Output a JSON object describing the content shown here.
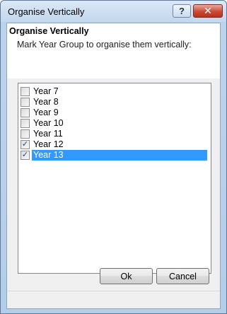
{
  "window": {
    "title": "Organise Vertically",
    "help_label": "?",
    "close_label": "✕"
  },
  "header": {
    "title": "Organise Vertically",
    "description": "Mark Year Group to organise them vertically:"
  },
  "year_groups": [
    {
      "label": "Year  7",
      "checked": false,
      "selected": false
    },
    {
      "label": "Year  8",
      "checked": false,
      "selected": false
    },
    {
      "label": "Year  9",
      "checked": false,
      "selected": false
    },
    {
      "label": "Year 10",
      "checked": false,
      "selected": false
    },
    {
      "label": "Year 11",
      "checked": false,
      "selected": false
    },
    {
      "label": "Year 12",
      "checked": true,
      "selected": false
    },
    {
      "label": "Year 13",
      "checked": true,
      "selected": true
    }
  ],
  "buttons": {
    "ok": "Ok",
    "cancel": "Cancel"
  }
}
